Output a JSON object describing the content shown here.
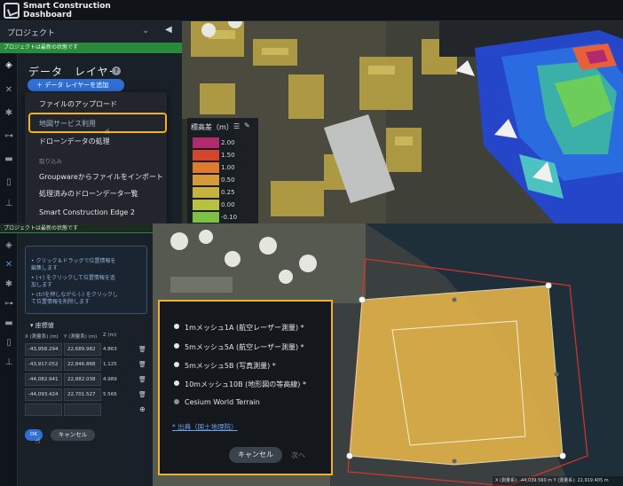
{
  "top": {
    "app_title": "Smart Construction\nDashboard",
    "project_label": "プロジェクト",
    "status_text": "プロジェクトは最新の状態です",
    "panel_title": "データ　レイヤー",
    "add_layer_label": "＋ データ レイヤーを追加",
    "menu": {
      "items": [
        {
          "label": "ファイルのアップロード"
        },
        {
          "label": "地図サービス利用"
        },
        {
          "label": "ドローンデータの処理"
        },
        {
          "label": "取り込み"
        },
        {
          "label": "Groupwareからファイルをインポート"
        },
        {
          "label": "処理済みのドローンデータ一覧"
        },
        {
          "label": "Smart Construction Edge 2"
        }
      ]
    },
    "legend": {
      "title": "標高差（m）",
      "entries": [
        {
          "label": "2.00",
          "color": "#b12a6e"
        },
        {
          "label": "1.50",
          "color": "#d4452a"
        },
        {
          "label": "1.00",
          "color": "#e07a2c"
        },
        {
          "label": "0.50",
          "color": "#d69a3a"
        },
        {
          "label": "0.25",
          "color": "#c8b23c"
        },
        {
          "label": "0.00",
          "color": "#b9c23e"
        },
        {
          "label": "-0.10",
          "color": "#7cc144"
        }
      ]
    }
  },
  "bottom": {
    "status_text": "プロジェクトは最新の状態です",
    "hints": [
      "• クリック＆ドラッグで位置情報を\n  編集します",
      "• (+) をクリックして位置情報を追\n  加します",
      "• ctrlを押しながら (-) をクリックし\n  て位置情報を削除します"
    ],
    "coord_header": "座標値",
    "columns": {
      "x": "X (測量系) (m)",
      "y": "Y (測量系) (m)",
      "z": "Z (m)"
    },
    "rows": [
      {
        "x": "-43,958.294",
        "y": "22,689.982",
        "z": "4.863"
      },
      {
        "x": "-43,917.052",
        "y": "22,846.868",
        "z": "1.125"
      },
      {
        "x": "-44,082.941",
        "y": "22,882.038",
        "z": "4.989"
      },
      {
        "x": "-44,093.424",
        "y": "22,701.527",
        "z": "5.566"
      }
    ],
    "ok_label": "OK",
    "cancel_label": "キャンセル",
    "dialog": {
      "options": [
        {
          "label": "1mメッシュ1A (航空レーザー測量) *"
        },
        {
          "label": "5mメッシュ5A (航空レーザー測量) *"
        },
        {
          "label": "5mメッシュ5B (写真測量) *"
        },
        {
          "label": "10mメッシュ10B (地形図の等高線) *"
        },
        {
          "label": "Cesium World Terrain"
        }
      ],
      "source_link": "* 出典（国土地理院）",
      "cancel_label": "キャンセル",
      "next_label": "次へ"
    },
    "coord_readout": "X (測量系): -44,039.560 m     Y (測量系): 22,919.405 m"
  }
}
